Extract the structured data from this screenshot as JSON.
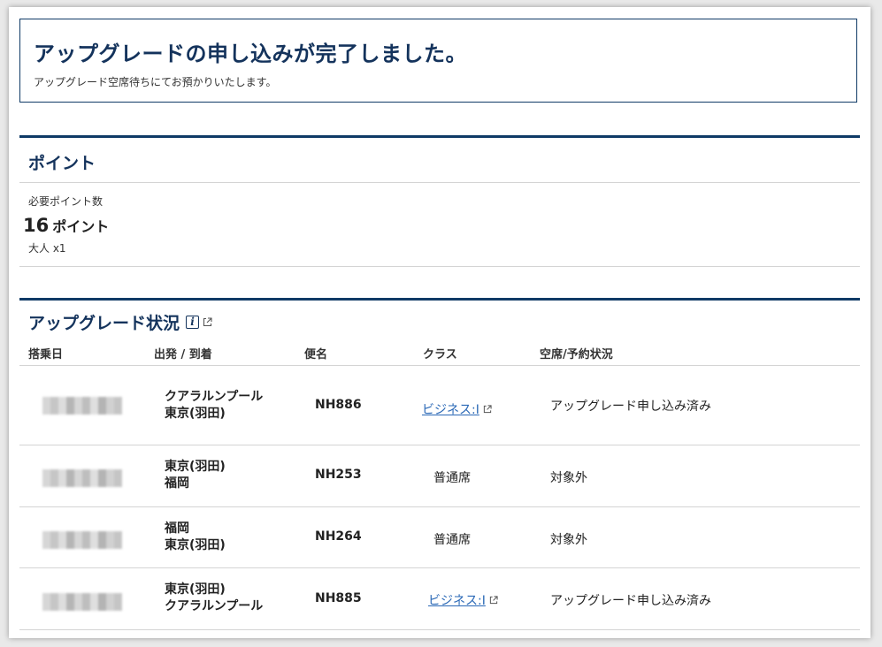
{
  "banner": {
    "title": "アップグレードの申し込みが完了しました。",
    "subtitle": "アップグレード空席待ちにてお預かりいたします。"
  },
  "points": {
    "section_title": "ポイント",
    "required_label": "必要ポイント数",
    "value": "16",
    "unit": "ポイント",
    "passengers": "大人 x1"
  },
  "status": {
    "section_title": "アップグレード状況",
    "columns": {
      "date": "搭乗日",
      "route": "出発 / 到着",
      "flight": "便名",
      "class": "クラス",
      "seat": "空席/予約状況"
    },
    "rows": [
      {
        "origin": "クアラルンプール",
        "destination": "東京(羽田)",
        "flight": "NH886",
        "class": "ビジネス:I",
        "class_is_link": true,
        "seat_status": "アップグレード申し込み済み"
      },
      {
        "origin": "東京(羽田)",
        "destination": "福岡",
        "flight": "NH253",
        "class": "普通席",
        "class_is_link": false,
        "seat_status": "対象外"
      },
      {
        "origin": "福岡",
        "destination": "東京(羽田)",
        "flight": "NH264",
        "class": "普通席",
        "class_is_link": false,
        "seat_status": "対象外"
      },
      {
        "origin": "東京(羽田)",
        "destination": "クアラルンプール",
        "flight": "NH885",
        "class": "ビジネス:I",
        "class_is_link": true,
        "seat_status": "アップグレード申し込み済み"
      }
    ]
  },
  "icons": {
    "info": "info-icon",
    "external_link": "external-link-icon"
  },
  "colors": {
    "heading": "#14335c",
    "rule": "#0f3a66",
    "link": "#2a68b6"
  }
}
